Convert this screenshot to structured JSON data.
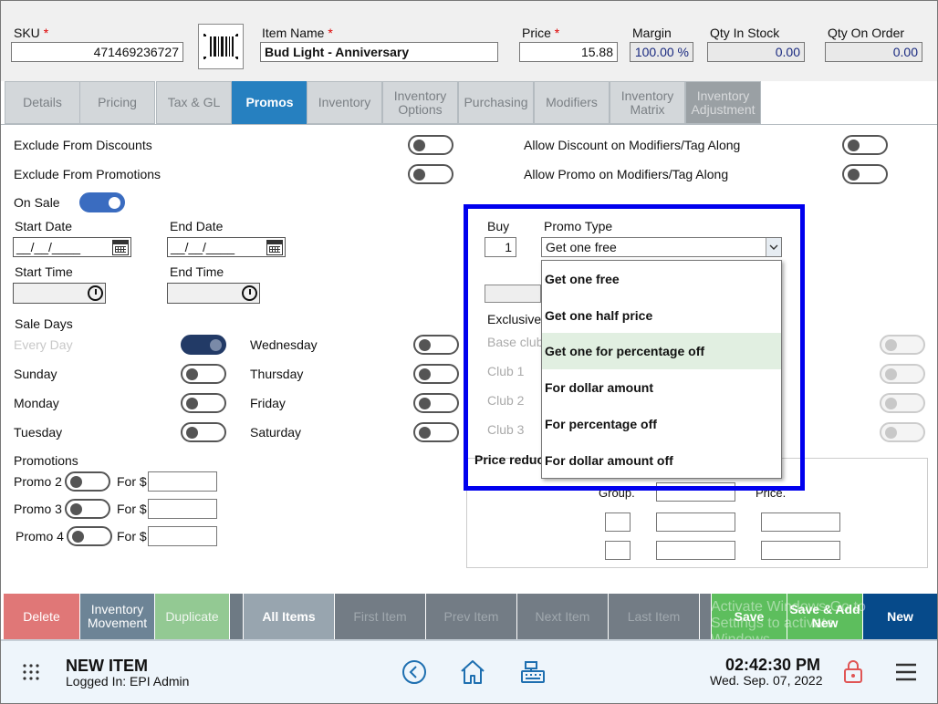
{
  "header": {
    "sku_label": "SKU",
    "sku_value": "471469236727",
    "item_name_label": "Item Name",
    "item_name_value": "Bud Light - Anniversary",
    "price_label": "Price",
    "price_value": "15.88",
    "margin_label": "Margin",
    "margin_value": "100.00 %",
    "qty_in_stock_label": "Qty In Stock",
    "qty_in_stock_value": "0.00",
    "qty_on_order_label": "Qty On Order",
    "qty_on_order_value": "0.00",
    "required_marker": "*"
  },
  "tabs": [
    {
      "label": "Details"
    },
    {
      "label": "Pricing"
    },
    {
      "label": "Tax & GL"
    },
    {
      "label": "Promos"
    },
    {
      "label": "Inventory"
    },
    {
      "label": "Inventory Options"
    },
    {
      "label": "Purchasing"
    },
    {
      "label": "Modifiers"
    },
    {
      "label": "Inventory Matrix"
    },
    {
      "label": "Inventory Adjustment"
    }
  ],
  "promos": {
    "exclude_discounts": "Exclude From Discounts",
    "exclude_promotions": "Exclude From Promotions",
    "allow_discount_modifiers": "Allow Discount on Modifiers/Tag Along",
    "allow_promo_modifiers": "Allow Promo on Modifiers/Tag Along",
    "on_sale": "On Sale",
    "start_date": "Start Date",
    "end_date": "End Date",
    "date_placeholder": "__/__/____",
    "start_time": "Start Time",
    "end_time": "End Time",
    "sale_days": "Sale Days",
    "days": {
      "every_day": "Every Day",
      "sunday": "Sunday",
      "monday": "Monday",
      "tuesday": "Tuesday",
      "wednesday": "Wednesday",
      "thursday": "Thursday",
      "friday": "Friday",
      "saturday": "Saturday"
    },
    "promotions": "Promotions",
    "promo2": "Promo 2",
    "promo3": "Promo 3",
    "promo4": "Promo 4",
    "for_dollar": "For $",
    "buy_label": "Buy",
    "buy_value": "1",
    "promo_type_label": "Promo Type",
    "promo_type_value": "Get one free",
    "exclusive": "Exclusive",
    "base_club": "Base club",
    "club1": "Club 1",
    "club2": "Club 2",
    "club3": "Club 3",
    "price_reduc": "Price reduc",
    "group_label": "Group.",
    "price_label": "Price."
  },
  "promo_options": [
    "Get one free",
    "Get one half price",
    "Get one for percentage off",
    "For dollar amount",
    "For percentage off",
    "For dollar amount off"
  ],
  "bottom_buttons": {
    "delete": "Delete",
    "inventory_movement": "Inventory Movement",
    "duplicate": "Duplicate",
    "all_items": "All Items",
    "first_item": "First Item",
    "prev_item": "Prev Item",
    "next_item": "Next Item",
    "last_item": "Last Item",
    "save": "Save",
    "save_add_new": "Save & Add New",
    "new": "New",
    "watermark": "Activate Windows Go to Settings to activate Windows."
  },
  "footer": {
    "title": "NEW ITEM",
    "logged_in": "Logged In:  EPI Admin",
    "time": "02:42:30 PM",
    "date": "Wed. Sep. 07, 2022"
  },
  "colors": {
    "active_tab": "#2680c0",
    "highlight_border": "#0000ee",
    "delete": "#e07777",
    "new": "#064a8a",
    "save": "#5dbe5d"
  }
}
